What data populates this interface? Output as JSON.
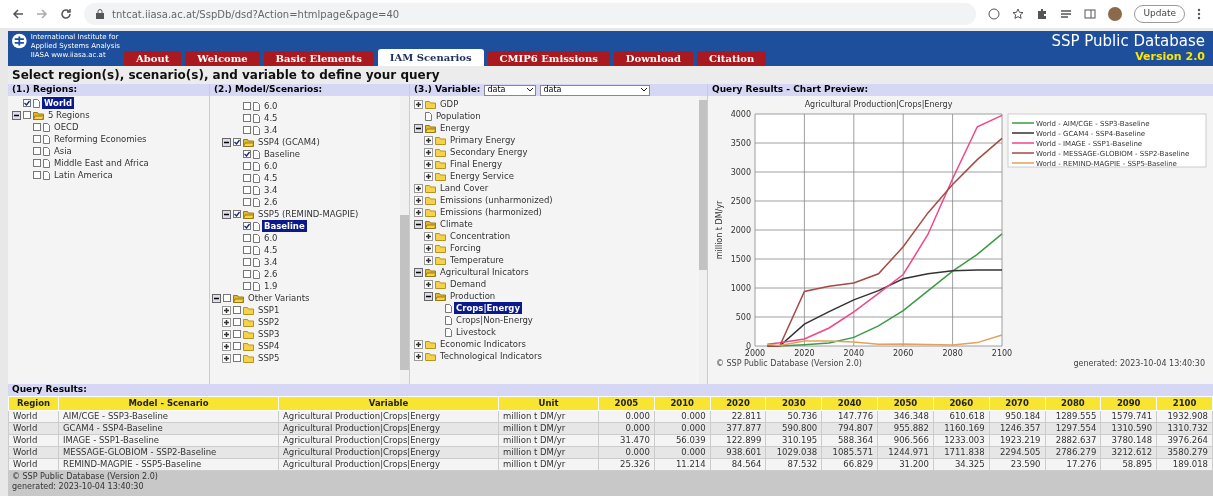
{
  "browser": {
    "url": "tntcat.iiasa.ac.at/SspDb/dsd?Action=htmlpage&page=40",
    "update_button": "Update"
  },
  "header": {
    "logo_lines": [
      "International Institute for",
      "Applied Systems Analysis",
      "IIASA www.iiasa.ac.at"
    ],
    "title": "SSP Public Database",
    "version": "Version 2.0",
    "tabs": [
      {
        "label": "About",
        "selected": false
      },
      {
        "label": "Welcome",
        "selected": false
      },
      {
        "label": "Basic Elements",
        "selected": false
      },
      {
        "label": "IAM Scenarios",
        "selected": true
      },
      {
        "label": "CMIP6 Emissions",
        "selected": false
      },
      {
        "label": "Download",
        "selected": false
      },
      {
        "label": "Citation",
        "selected": false
      }
    ]
  },
  "instruction": "Select region(s), scenario(s), and variable to define your query",
  "regions": {
    "title": "(1.) Regions:",
    "tree": [
      {
        "label": "World",
        "kind": "leaf",
        "checked": true,
        "selected": true
      },
      {
        "label": "5 Regions",
        "kind": "folder",
        "expanded": true,
        "checked": false,
        "selected": false,
        "children": [
          {
            "label": "OECD",
            "kind": "leaf",
            "checked": false,
            "selected": false
          },
          {
            "label": "Reforming Economies",
            "kind": "leaf",
            "checked": false,
            "selected": false
          },
          {
            "label": "Asia",
            "kind": "leaf",
            "checked": false,
            "selected": false
          },
          {
            "label": "Middle East and Africa",
            "kind": "leaf",
            "checked": false,
            "selected": false
          },
          {
            "label": "Latin America",
            "kind": "leaf",
            "checked": false,
            "selected": false
          }
        ]
      }
    ]
  },
  "scenarios": {
    "title": "(2.) Model/Scenarios:",
    "tree": [
      {
        "kind": "cut_group",
        "children": [
          {
            "kind": "cut_group",
            "children": [
              {
                "label": "6.0",
                "kind": "leaf",
                "checked": false,
                "selected": false
              },
              {
                "label": "4.5",
                "kind": "leaf",
                "checked": false,
                "selected": false
              },
              {
                "label": "3.4",
                "kind": "leaf",
                "checked": false,
                "selected": false
              }
            ]
          },
          {
            "label": "SSP4 (GCAM4)",
            "kind": "folder",
            "expanded": true,
            "checked": true,
            "selected": false,
            "children": [
              {
                "label": "Baseline",
                "kind": "leaf",
                "checked": true,
                "selected": false
              },
              {
                "label": "6.0",
                "kind": "leaf",
                "checked": false,
                "selected": false
              },
              {
                "label": "4.5",
                "kind": "leaf",
                "checked": false,
                "selected": false
              },
              {
                "label": "3.4",
                "kind": "leaf",
                "checked": false,
                "selected": false
              },
              {
                "label": "2.6",
                "kind": "leaf",
                "checked": false,
                "selected": false
              }
            ]
          },
          {
            "label": "SSP5 (REMIND-MAGPIE)",
            "kind": "folder",
            "expanded": true,
            "checked": true,
            "selected": false,
            "children": [
              {
                "label": "Baseline",
                "kind": "leaf",
                "checked": true,
                "selected": true
              },
              {
                "label": "6.0",
                "kind": "leaf",
                "checked": false,
                "selected": false
              },
              {
                "label": "4.5",
                "kind": "leaf",
                "checked": false,
                "selected": false
              },
              {
                "label": "3.4",
                "kind": "leaf",
                "checked": false,
                "selected": false
              },
              {
                "label": "2.6",
                "kind": "leaf",
                "checked": false,
                "selected": false
              },
              {
                "label": "1.9",
                "kind": "leaf",
                "checked": false,
                "selected": false
              }
            ]
          }
        ]
      },
      {
        "label": "Other Variants",
        "kind": "folder",
        "expanded": true,
        "checked": false,
        "selected": false,
        "children": [
          {
            "label": "SSP1",
            "kind": "folder",
            "expanded": false,
            "checked": false,
            "selected": false
          },
          {
            "label": "SSP2",
            "kind": "folder",
            "expanded": false,
            "checked": false,
            "selected": false
          },
          {
            "label": "SSP3",
            "kind": "folder",
            "expanded": false,
            "checked": false,
            "selected": false
          },
          {
            "label": "SSP4",
            "kind": "folder",
            "expanded": false,
            "checked": false,
            "selected": false
          },
          {
            "label": "SSP5",
            "kind": "folder",
            "expanded": false,
            "checked": false,
            "selected": false
          }
        ]
      }
    ]
  },
  "variables": {
    "title": "(3.) Variable:",
    "select_1": "data",
    "select_2": "data",
    "tree": [
      {
        "label": "GDP",
        "kind": "folder",
        "expanded": false,
        "selected": false
      },
      {
        "label": "Population",
        "kind": "leaf",
        "selected": false
      },
      {
        "label": "Energy",
        "kind": "folder",
        "expanded": true,
        "selected": false,
        "children": [
          {
            "label": "Primary Energy",
            "kind": "folder",
            "expanded": false,
            "selected": false
          },
          {
            "label": "Secondary Energy",
            "kind": "folder",
            "expanded": false,
            "selected": false
          },
          {
            "label": "Final Energy",
            "kind": "folder",
            "expanded": false,
            "selected": false
          },
          {
            "label": "Energy Service",
            "kind": "folder",
            "expanded": false,
            "selected": false
          }
        ]
      },
      {
        "label": "Land Cover",
        "kind": "folder",
        "expanded": false,
        "selected": false
      },
      {
        "label": "Emissions (unharmonized)",
        "kind": "folder",
        "expanded": false,
        "selected": false
      },
      {
        "label": "Emissions (harmonized)",
        "kind": "folder",
        "expanded": false,
        "selected": false
      },
      {
        "label": "Climate",
        "kind": "folder",
        "expanded": true,
        "selected": false,
        "children": [
          {
            "label": "Concentration",
            "kind": "folder",
            "expanded": false,
            "selected": false
          },
          {
            "label": "Forcing",
            "kind": "folder",
            "expanded": false,
            "selected": false
          },
          {
            "label": "Temperature",
            "kind": "folder",
            "expanded": false,
            "selected": false
          }
        ]
      },
      {
        "label": "Agricultural Inicators",
        "kind": "folder",
        "expanded": true,
        "selected": false,
        "children": [
          {
            "label": "Demand",
            "kind": "folder",
            "expanded": false,
            "selected": false
          },
          {
            "label": "Production",
            "kind": "folder",
            "expanded": true,
            "selected": false,
            "children": [
              {
                "label": "Crops|Energy",
                "kind": "leaf",
                "selected": true
              },
              {
                "label": "Crops|Non-Energy",
                "kind": "leaf",
                "selected": false
              },
              {
                "label": "Livestock",
                "kind": "leaf",
                "selected": false
              }
            ]
          }
        ]
      },
      {
        "label": "Economic Indicators",
        "kind": "folder",
        "expanded": false,
        "selected": false
      },
      {
        "label": "Technological Indicators",
        "kind": "folder",
        "expanded": false,
        "selected": false
      }
    ]
  },
  "chart_panel": {
    "title": "Query Results - Chart Preview:",
    "copyright": "© SSP Public Database (Version 2.0)",
    "generated": "generated: 2023-10-04 13:40:30",
    "chart_data": {
      "type": "line",
      "grid": true,
      "legend": "upper right, outside plot",
      "title": "Agricultural Production|Crops|Energy",
      "ylabel": "million t DM/yr",
      "x": [
        2005,
        2010,
        2020,
        2030,
        2040,
        2050,
        2060,
        2070,
        2080,
        2090,
        2100
      ],
      "xlim": [
        2000,
        2100
      ],
      "ylim": [
        0,
        4000
      ],
      "xticks": [
        2000,
        2020,
        2040,
        2060,
        2080,
        2100
      ],
      "yticks": [
        0,
        500,
        1000,
        1500,
        2000,
        2500,
        3000,
        3500,
        4000
      ],
      "series": [
        {
          "name": "World - AIM/CGE - SSP3-Baseline",
          "color": "#3c9a46",
          "values": [
            0,
            0,
            23,
            51,
            148,
            346,
            611,
            950,
            1290,
            1580,
            1933
          ]
        },
        {
          "name": "World - GCAM4 - SSP4-Baseline",
          "color": "#333333",
          "values": [
            0,
            0,
            378,
            591,
            795,
            956,
            1160,
            1246,
            1298,
            1311,
            1311
          ]
        },
        {
          "name": "World - IMAGE - SSP1-Baseline",
          "color": "#f0468c",
          "values": [
            31,
            56,
            123,
            310,
            588,
            907,
            1233,
            1923,
            2883,
            3780,
            3976
          ]
        },
        {
          "name": "World - MESSAGE-GLOBIOM - SSP2-Baseline",
          "color": "#a54b44",
          "values": [
            0,
            0,
            939,
            1029,
            1086,
            1245,
            1712,
            2295,
            2786,
            3213,
            3580
          ]
        },
        {
          "name": "World - REMIND-MAGPIE - SSP5-Baseline",
          "color": "#e3a25a",
          "values": [
            25,
            11,
            85,
            88,
            67,
            31,
            34,
            24,
            17,
            59,
            189
          ]
        }
      ]
    }
  },
  "results": {
    "title": "Query Results:",
    "columns": [
      "Region",
      "Model - Scenario",
      "Variable",
      "Unit",
      "2005",
      "2010",
      "2020",
      "2030",
      "2040",
      "2050",
      "2060",
      "2070",
      "2080",
      "2090",
      "2100"
    ],
    "rows": [
      [
        "World",
        "AIM/CGE - SSP3-Baseline",
        "Agricultural Production|Crops|Energy",
        "million t DM/yr",
        "0.000",
        "0.000",
        "22.811",
        "50.736",
        "147.776",
        "346.348",
        "610.618",
        "950.184",
        "1289.555",
        "1579.741",
        "1932.908"
      ],
      [
        "World",
        "GCAM4 - SSP4-Baseline",
        "Agricultural Production|Crops|Energy",
        "million t DM/yr",
        "0.000",
        "0.000",
        "377.877",
        "590.800",
        "794.807",
        "955.882",
        "1160.169",
        "1246.357",
        "1297.554",
        "1310.590",
        "1310.732"
      ],
      [
        "World",
        "IMAGE - SSP1-Baseline",
        "Agricultural Production|Crops|Energy",
        "million t DM/yr",
        "31.470",
        "56.039",
        "122.899",
        "310.195",
        "588.364",
        "906.566",
        "1233.003",
        "1923.219",
        "2882.637",
        "3780.148",
        "3976.264"
      ],
      [
        "World",
        "MESSAGE-GLOBIOM - SSP2-Baseline",
        "Agricultural Production|Crops|Energy",
        "million t DM/yr",
        "0.000",
        "0.000",
        "938.601",
        "1029.038",
        "1085.571",
        "1244.971",
        "1711.838",
        "2294.505",
        "2786.279",
        "3212.612",
        "3580.279"
      ],
      [
        "World",
        "REMIND-MAGPIE - SSP5-Baseline",
        "Agricultural Production|Crops|Energy",
        "million t DM/yr",
        "25.326",
        "11.214",
        "84.564",
        "87.532",
        "66.829",
        "31.200",
        "34.325",
        "23.590",
        "17.276",
        "58.895",
        "189.018"
      ]
    ],
    "footer": [
      "© SSP Public Database (Version 2.0)",
      "generated: 2023-10-04 13:40:30"
    ]
  }
}
